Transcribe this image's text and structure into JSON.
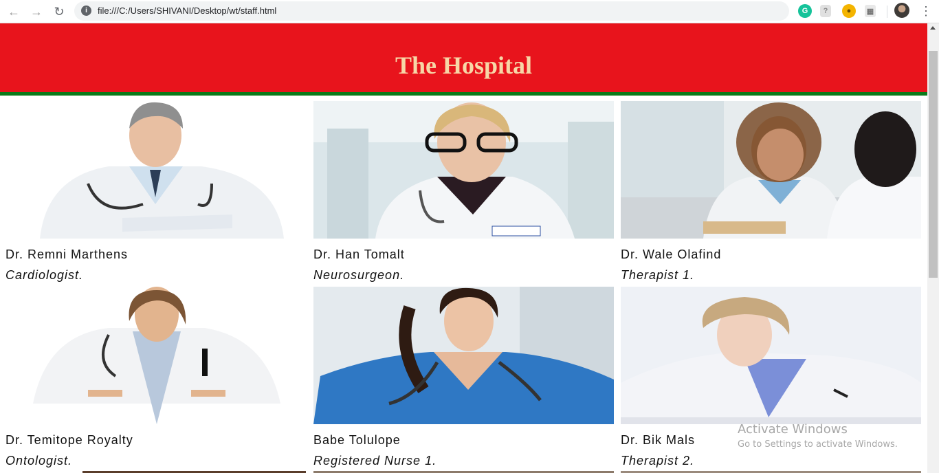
{
  "browser": {
    "url": "file:///C:/Users/SHIVANI/Desktop/wt/staff.html",
    "back_icon": "arrow-left-icon",
    "forward_icon": "arrow-right-icon",
    "reload_icon": "reload-icon",
    "info_icon": "info-icon",
    "extensions": [
      "grammarly-icon",
      "shield-icon",
      "cookie-icon",
      "document-icon"
    ],
    "menu_icon": "kebab-menu-icon"
  },
  "header": {
    "title": "The Hospital",
    "background": "#e8141c",
    "border_color": "#0a7a1a",
    "title_color": "#f7d7a7"
  },
  "staff": [
    {
      "name": "Dr. Remni Marthens",
      "role": "Cardiologist."
    },
    {
      "name": "Dr. Han Tomalt",
      "role": "Neurosurgeon."
    },
    {
      "name": "Dr. Wale Olafind",
      "role": "Therapist 1."
    },
    {
      "name": "Dr. Temitope Royalty",
      "role": "Ontologist."
    },
    {
      "name": "Babe Tolulope",
      "role": "Registered Nurse 1."
    },
    {
      "name": "Dr. Bik Mals",
      "role": "Therapist 2."
    }
  ],
  "watermark": {
    "line1": "Activate Windows",
    "line2": "Go to Settings to activate Windows."
  }
}
